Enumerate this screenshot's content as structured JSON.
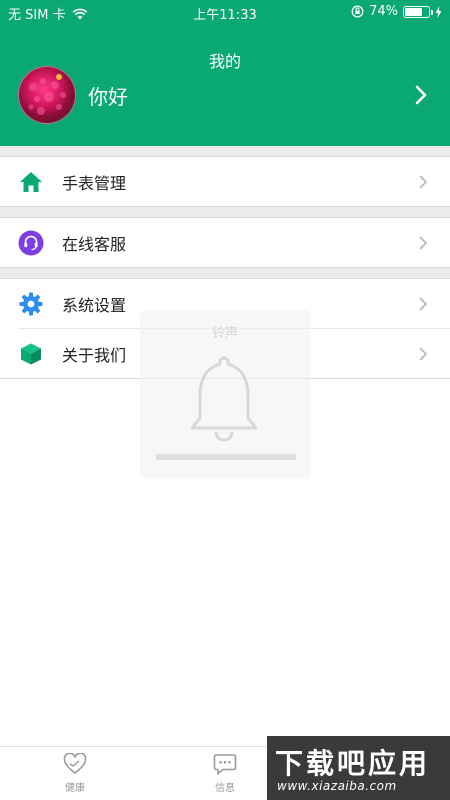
{
  "status_bar": {
    "carrier": "无 SIM 卡",
    "time": "上午11:33",
    "battery_pct_text": "74%",
    "battery_level": 0.74
  },
  "header": {
    "title": "我的",
    "profile_name": "你好"
  },
  "menu": {
    "items": [
      {
        "label": "手表管理",
        "icon": "home-icon",
        "color": "#0aa974"
      },
      {
        "label": "在线客服",
        "icon": "headset-icon",
        "color": "#7b3fe4"
      },
      {
        "label": "系统设置",
        "icon": "gear-icon",
        "color": "#2d8cf0"
      },
      {
        "label": "关于我们",
        "icon": "cube-icon",
        "color": "#0aa974"
      }
    ]
  },
  "ghost_overlay": {
    "title": "铃声"
  },
  "tabbar": {
    "tabs": [
      {
        "label": "健康",
        "icon": "heart-icon"
      },
      {
        "label": "信息",
        "icon": "chat-icon"
      }
    ]
  },
  "watermark": {
    "title": "下载吧应用",
    "url": "www.xiazaiba.com"
  },
  "colors": {
    "brand_green": "#0aa974",
    "band_gray": "#ececec"
  }
}
